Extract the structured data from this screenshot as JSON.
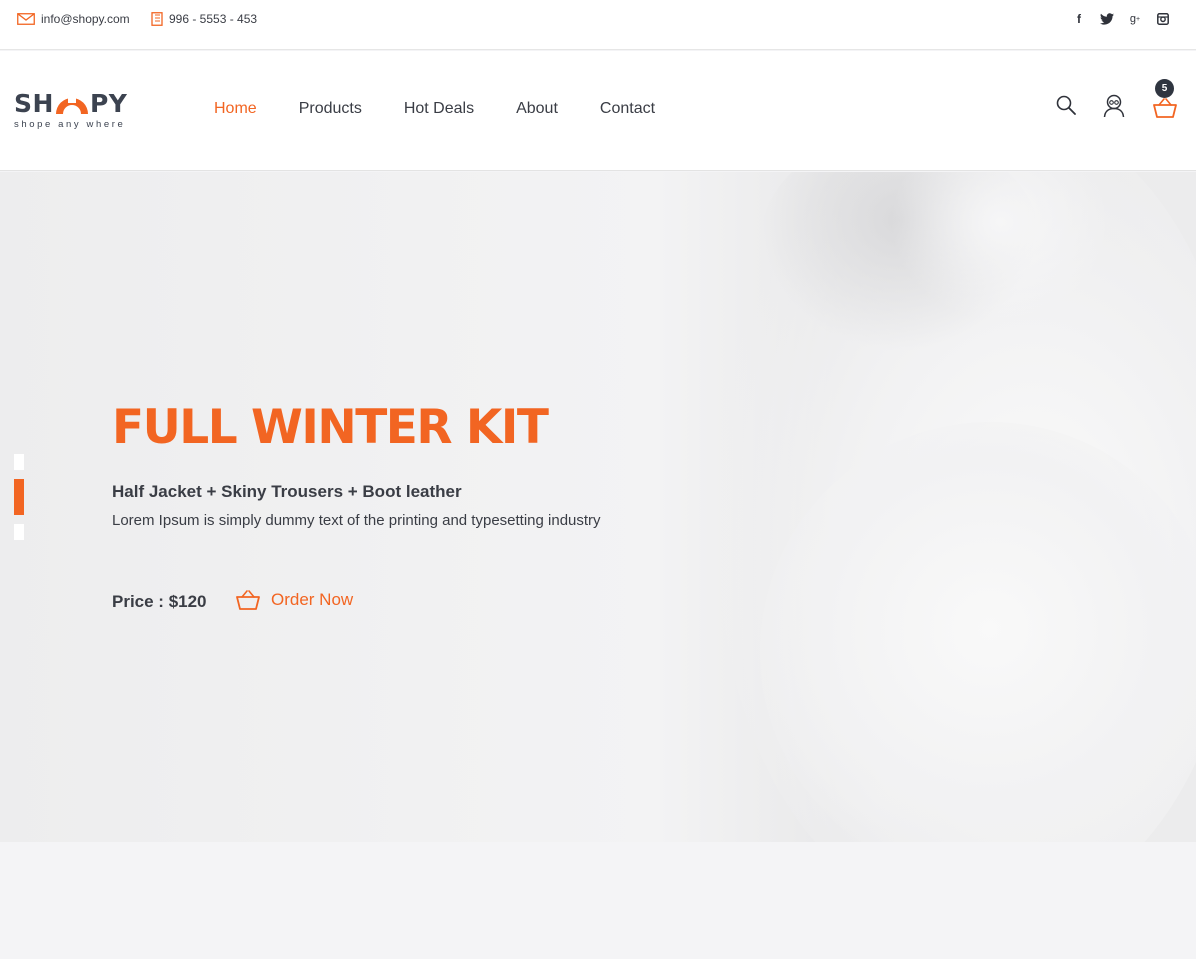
{
  "colors": {
    "accent": "#f26522",
    "text": "#3a3d45",
    "dark": "#2f3540"
  },
  "topbar": {
    "email": "info@shopy.com",
    "phone": "996 - 5553 - 453",
    "socials": [
      "facebook-icon",
      "twitter-icon",
      "google-plus-icon",
      "instagram-icon"
    ]
  },
  "logo": {
    "left": "SH",
    "right": "PY",
    "tagline": "shope any where"
  },
  "nav": {
    "items": [
      {
        "label": "Home",
        "active": true
      },
      {
        "label": "Products",
        "active": false
      },
      {
        "label": "Hot Deals",
        "active": false
      },
      {
        "label": "About",
        "active": false
      },
      {
        "label": "Contact",
        "active": false
      }
    ]
  },
  "header_icons": {
    "cart_count": "5",
    "icons": [
      "search-icon",
      "user-icon",
      "cart-icon"
    ]
  },
  "hero": {
    "title": "FULL WINTER KIT",
    "subtitle": "Half Jacket + Skiny Trousers + Boot leather",
    "description": "Lorem Ipsum is simply dummy text of the printing and typesetting industry",
    "price": "Price : $120",
    "order_label": "Order Now",
    "slides": {
      "count": 3,
      "active_index": 1
    }
  }
}
